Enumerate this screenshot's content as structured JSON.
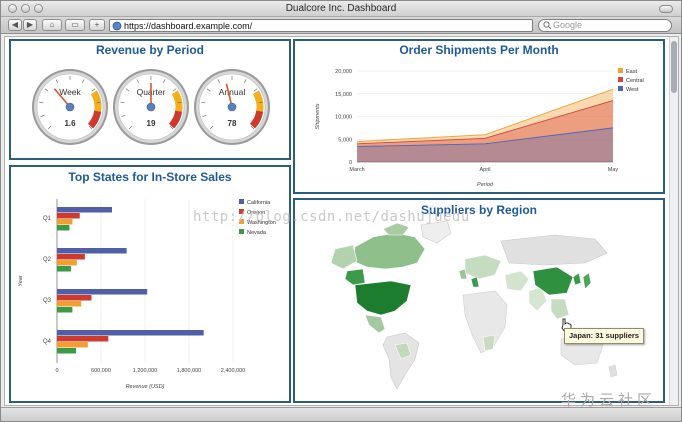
{
  "window": {
    "title": "Dualcore Inc. Dashboard",
    "url": "https://dashboard.example.com/",
    "search_placeholder": "Google"
  },
  "icons": [
    "back-icon",
    "forward-icon",
    "home-icon",
    "tabs-icon",
    "add-icon",
    "site-icon",
    "search-icon",
    "hand-cursor-icon"
  ],
  "revenue": {
    "title": "Revenue by Period",
    "gauges": [
      {
        "label": "Week",
        "value": "1.6",
        "level": 0.35
      },
      {
        "label": "Quarter",
        "value": "19",
        "level": 0.5
      },
      {
        "label": "Annual",
        "value": "78",
        "level": 0.45
      }
    ]
  },
  "shipments": {
    "title": "Order Shipments Per Month",
    "chart_data": {
      "type": "area",
      "title": "Order Shipments Per Month",
      "xlabel": "Period",
      "ylabel": "Shipments",
      "categories": [
        "March",
        "April",
        "May"
      ],
      "yticks": [
        "0",
        "5,000",
        "10,000",
        "15,000",
        "20,000"
      ],
      "ylim": [
        0,
        20000
      ],
      "stacked": true,
      "series": [
        {
          "name": "East",
          "values": [
            4500,
            6000,
            16000
          ],
          "color": "#f0a23a"
        },
        {
          "name": "Central",
          "values": [
            4000,
            5200,
            13500
          ],
          "color": "#d9443a"
        },
        {
          "name": "West",
          "values": [
            3400,
            4000,
            7500
          ],
          "color": "#4f64b4"
        }
      ]
    }
  },
  "states": {
    "title": "Top States for In-Store Sales",
    "chart_data": {
      "type": "bar",
      "title": "Top States for In-Store Sales",
      "xlabel": "Revenue (USD)",
      "ylabel": "Year",
      "categories": [
        "Q1",
        "Q2",
        "Q3",
        "Q4"
      ],
      "xticks": [
        "0",
        "600,000",
        "1,200,000",
        "1,800,000",
        "2,400,000"
      ],
      "xlim": [
        0,
        2400000
      ],
      "series": [
        {
          "name": "California",
          "values": [
            750000,
            950000,
            1230000,
            2000000
          ],
          "color": "#4f5fa8"
        },
        {
          "name": "Oregon",
          "values": [
            310000,
            380000,
            470000,
            700000
          ],
          "color": "#cf3a2f"
        },
        {
          "name": "Washington",
          "values": [
            210000,
            270000,
            330000,
            420000
          ],
          "color": "#f0a030"
        },
        {
          "name": "Nevada",
          "values": [
            170000,
            190000,
            210000,
            260000
          ],
          "color": "#3a9a48"
        }
      ]
    }
  },
  "suppliers": {
    "title": "Suppliers by Region",
    "tooltip": "Japan: 31 suppliers"
  },
  "watermarks": {
    "blog": "http://blog.csdn.net/dashujuedu",
    "site": "华为云社区"
  }
}
